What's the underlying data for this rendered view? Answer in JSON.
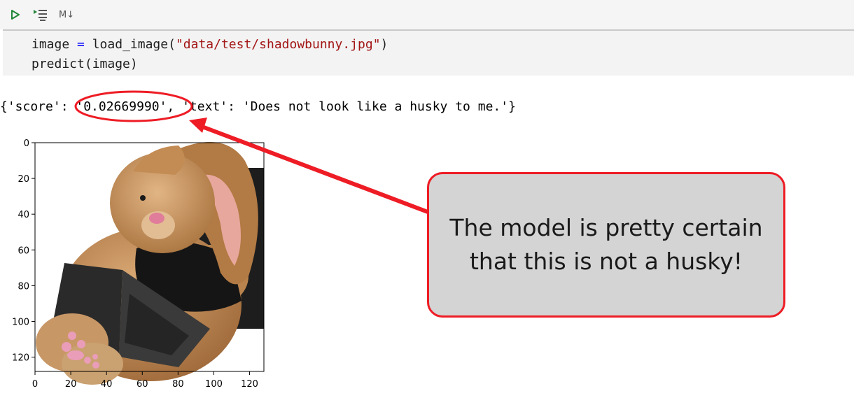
{
  "toolbar": {
    "run_icon": "play-icon",
    "run_below_icon": "run-below-icon",
    "markdown_label": "M↓",
    "colors": {
      "run": "#22863a"
    }
  },
  "cell": {
    "line1": {
      "var": "image",
      "op": "=",
      "func": "load_image(",
      "arg": "\"data/test/shadowbunny.jpg\"",
      "close": ")"
    },
    "line2": "predict(image)"
  },
  "output": {
    "open": "{'score': ",
    "score": "'0.02669990'",
    "rest": ", 'text': 'Does not look like a husky to me.'}"
  },
  "plot": {
    "y_ticks": [
      "0",
      "20",
      "40",
      "60",
      "80",
      "100",
      "120"
    ],
    "x_ticks": [
      "0",
      "20",
      "40",
      "60",
      "80",
      "100",
      "120"
    ],
    "image_subject": "plush bunny with laptop"
  },
  "callout": {
    "line1": "The model is pretty certain",
    "line2": "that this is not a husky!"
  },
  "colors": {
    "accent_red": "#ee1c25",
    "callout_bg": "#d4d4d4",
    "string": "#a31515",
    "operator": "#0000ff"
  }
}
